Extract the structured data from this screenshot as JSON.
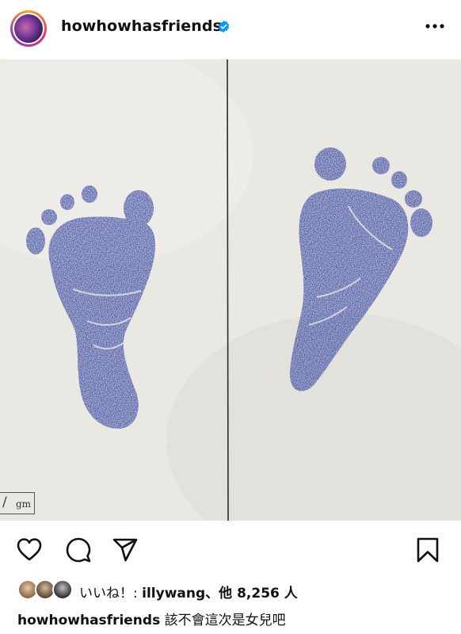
{
  "post": {
    "username": "howhowhasfriends",
    "verified": true,
    "more_icon": "more-horizontal-icon",
    "photo": {
      "description_icon": "footprints-photo",
      "stamp_slash": "/",
      "stamp_unit": "gm",
      "ink_color": "#2e3f9e",
      "paper_color": "#e8e7e2"
    },
    "actions": {
      "like_icon": "heart-icon",
      "comment_icon": "comment-icon",
      "share_icon": "send-icon",
      "save_icon": "bookmark-icon"
    },
    "likes": {
      "prefix": "いいね！: ",
      "user": "illywang",
      "separator": "、",
      "others": "他 8,256 人"
    },
    "caption": {
      "user": "howhowhasfriends",
      "text": " 該不會這次是女兒吧"
    }
  },
  "colors": {
    "verified_blue": "#0095f6",
    "text": "#111111"
  }
}
